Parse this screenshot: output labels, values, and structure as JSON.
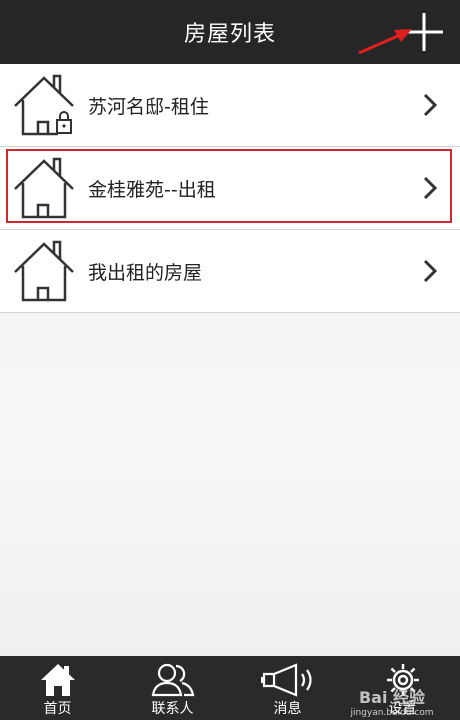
{
  "header": {
    "title": "房屋列表",
    "add_icon": "plus-icon"
  },
  "houses": [
    {
      "label": "苏河名邸-租住",
      "icon": "house-lock-icon",
      "highlighted": false
    },
    {
      "label": "金桂雅苑--出租",
      "icon": "house-icon",
      "highlighted": true
    },
    {
      "label": "我出租的房屋",
      "icon": "house-icon",
      "highlighted": false
    }
  ],
  "tabs": [
    {
      "label": "首页",
      "icon": "home-icon"
    },
    {
      "label": "联系人",
      "icon": "contacts-icon"
    },
    {
      "label": "消息",
      "icon": "megaphone-icon"
    },
    {
      "label": "设置",
      "icon": "gear-icon"
    }
  ],
  "watermark": {
    "brand": "Bai 经验",
    "url": "jingyan.baidu.com"
  },
  "colors": {
    "header_bg": "#262626",
    "highlight_border": "#d02830",
    "annotation_arrow": "#e02020"
  }
}
